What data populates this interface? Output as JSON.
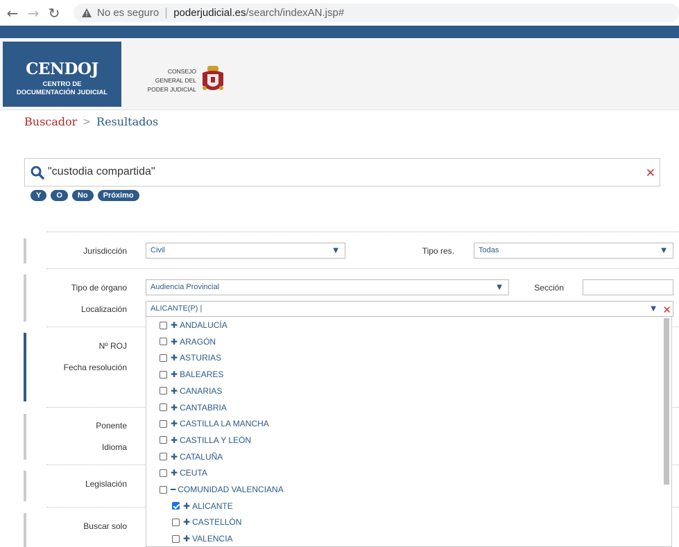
{
  "browser": {
    "not_secure": "No es seguro",
    "url_host": "poderjudicial.es",
    "url_path": "/search/indexAN.jsp#"
  },
  "header": {
    "logo_title": "CENDOJ",
    "logo_sub1": "CENTRO DE",
    "logo_sub2": "DOCUMENTACIÓN JUDICIAL",
    "cgpj1": "CONSEJO",
    "cgpj2": "GENERAL DEL",
    "cgpj3": "PODER JUDICIAL"
  },
  "breadcrumb": {
    "home": "Buscador",
    "separator": ">",
    "current": "Resultados"
  },
  "search": {
    "query": "\"custodia compartida\"",
    "clear": "✕"
  },
  "operators": [
    "Y",
    "O",
    "No",
    "Próximo"
  ],
  "form": {
    "jurisdiccion_label": "Jurisdicción",
    "jurisdiccion_value": "Civil",
    "tipo_res_label": "Tipo res.",
    "tipo_res_value": "Todas",
    "tipo_organo_label": "Tipo de órgano",
    "tipo_organo_value": "Audiencia Provincial",
    "seccion_label": "Sección",
    "localizacion_label": "Localización",
    "localizacion_value": "ALICANTE(P) |",
    "nroj_label": "Nº ROJ",
    "fecha_label": "Fecha resolución",
    "ponente_label": "Ponente",
    "idioma_label": "Idioma",
    "legislacion_label": "Legislación",
    "buscar_solo_label": "Buscar solo",
    "arrow": "▼",
    "clear": "✕"
  },
  "tree": [
    {
      "label": "ANDALUCÍA",
      "exp": "✚",
      "checked": false,
      "level": 0
    },
    {
      "label": "ARAGÓN",
      "exp": "✚",
      "checked": false,
      "level": 0
    },
    {
      "label": "ASTURIAS",
      "exp": "✚",
      "checked": false,
      "level": 0
    },
    {
      "label": "BALEARES",
      "exp": "✚",
      "checked": false,
      "level": 0
    },
    {
      "label": "CANARIAS",
      "exp": "✚",
      "checked": false,
      "level": 0
    },
    {
      "label": "CANTABRIA",
      "exp": "✚",
      "checked": false,
      "level": 0
    },
    {
      "label": "CASTILLA LA MANCHA",
      "exp": "✚",
      "checked": false,
      "level": 0
    },
    {
      "label": "CASTILLA Y LEÓN",
      "exp": "✚",
      "checked": false,
      "level": 0
    },
    {
      "label": "CATALUÑA",
      "exp": "✚",
      "checked": false,
      "level": 0
    },
    {
      "label": "CEUTA",
      "exp": "✚",
      "checked": false,
      "level": 0
    },
    {
      "label": "COMUNIDAD VALENCIANA",
      "exp": "━",
      "checked": false,
      "level": 0
    },
    {
      "label": "ALICANTE",
      "exp": "✚",
      "checked": true,
      "level": 1
    },
    {
      "label": "CASTELLÓN",
      "exp": "✚",
      "checked": false,
      "level": 1
    },
    {
      "label": "VALENCIA",
      "exp": "✚",
      "checked": false,
      "level": 1
    }
  ],
  "colors": {
    "brand": "#2e5a8a",
    "accent_red": "#b3262d",
    "checkbox": "#1a73e8"
  }
}
